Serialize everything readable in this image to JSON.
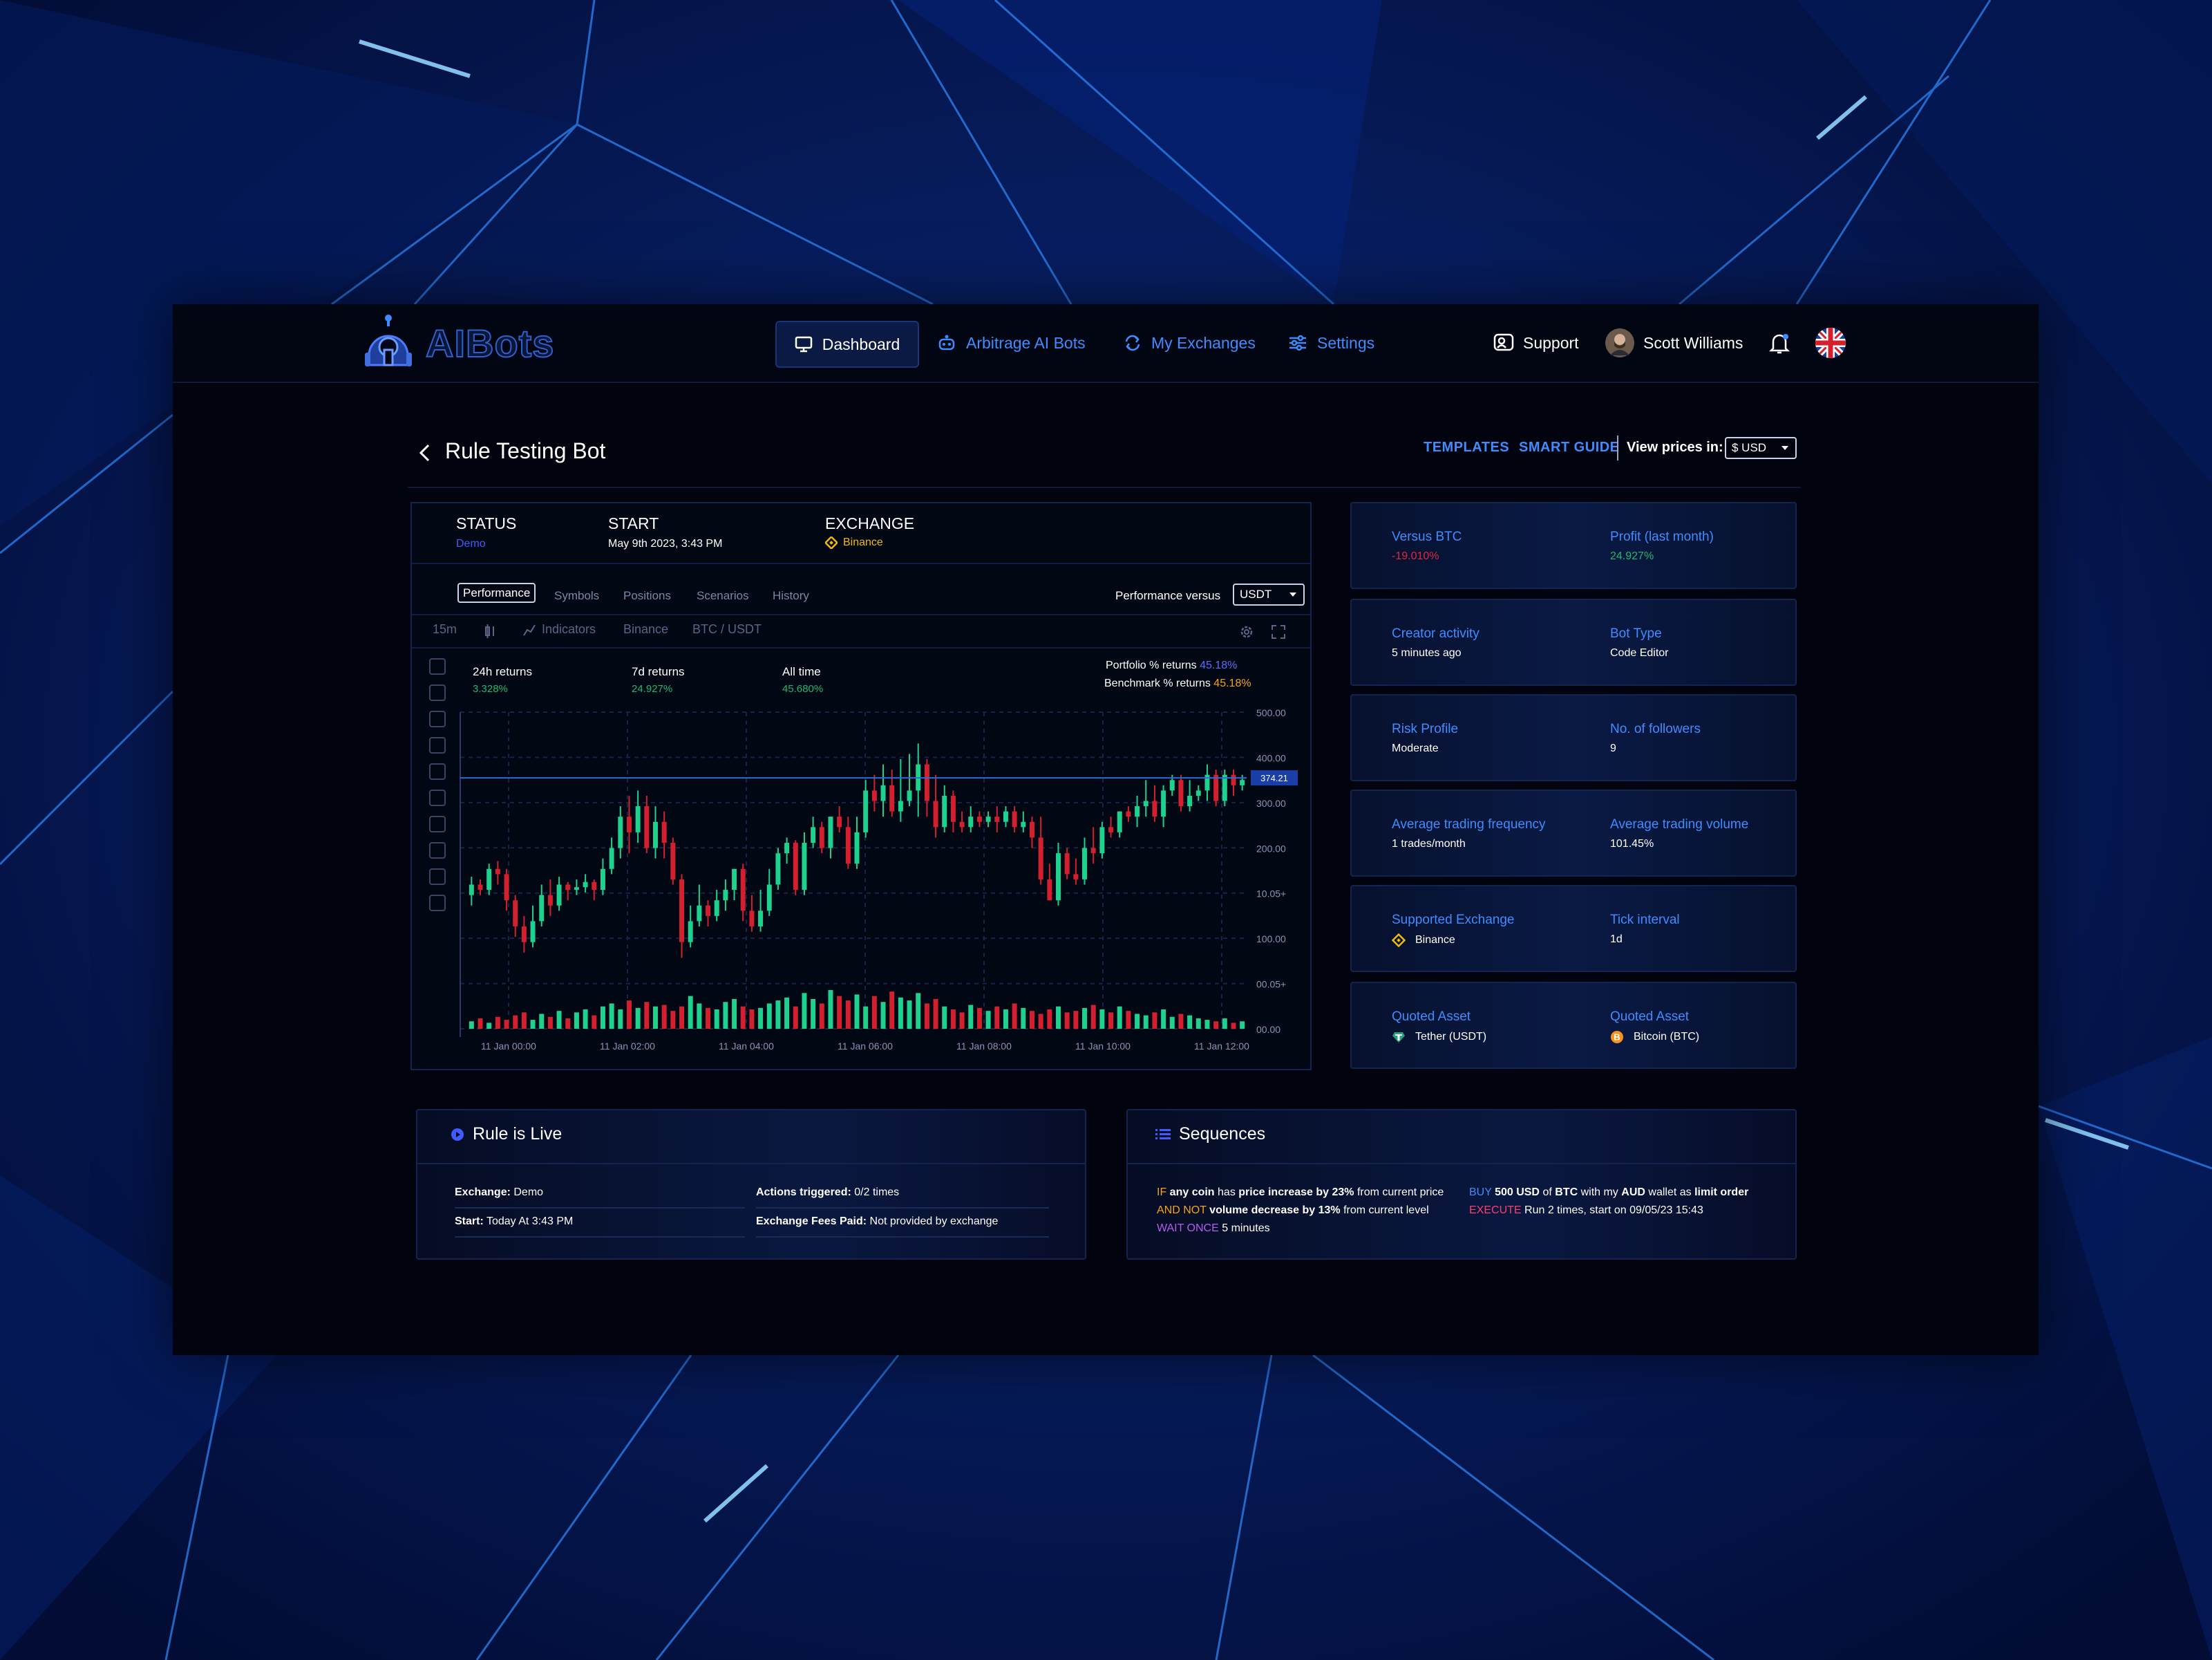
{
  "brand": {
    "name": "AIBots"
  },
  "nav": {
    "dashboard": "Dashboard",
    "arbitrage": "Arbitrage AI Bots",
    "exchanges": "My Exchanges",
    "settings": "Settings"
  },
  "header": {
    "support": "Support",
    "user_name": "Scott Williams",
    "language_flag": "uk-flag-icon"
  },
  "page": {
    "title": "Rule Testing Bot",
    "templates": "TEMPLATES",
    "smart_guide": "SMART GUIDE",
    "view_prices_label": "View prices in:",
    "currency": "$ USD"
  },
  "status": {
    "status_label": "STATUS",
    "status_value": "Demo",
    "start_label": "START",
    "start_value": "May 9th 2023, 3:43 PM",
    "exchange_label": "EXCHANGE",
    "exchange_value": "Binance"
  },
  "tabs": [
    "Performance",
    "Symbols",
    "Positions",
    "Scenarios",
    "History"
  ],
  "performance_versus": {
    "label": "Performance versus",
    "value": "USDT"
  },
  "toolbar": {
    "interval": "15m",
    "indicators": "Indicators",
    "exchange": "Binance",
    "pair": "BTC / USDT"
  },
  "returns": {
    "r24_label": "24h returns",
    "r24_value": "3.328%",
    "r7_label": "7d returns",
    "r7_value": "24.927%",
    "all_label": "All time",
    "all_value": "45.680%",
    "portfolio_label": "Portfolio % returns",
    "portfolio_value": "45.18%",
    "benchmark_label": "Benchmark % returns",
    "benchmark_value": "45.18%"
  },
  "chart_data": {
    "type": "candlestick",
    "x_ticks": [
      "11 Jan 00:00",
      "11 Jan 02:00",
      "11 Jan 04:00",
      "11 Jan 06:00",
      "11 Jan 08:00",
      "11 Jan 10:00",
      "11 Jan 12:00"
    ],
    "y_ticks": [
      "500.00",
      "400.00",
      "300.00",
      "200.00",
      "10.05+",
      "100.00",
      "00.05+",
      "00.00"
    ],
    "ylim": [
      0,
      500
    ],
    "last_price": "374.21",
    "up_color": "#1fd18e",
    "down_color": "#d4202e",
    "candles": [
      [
        150,
        170,
        130,
        185
      ],
      [
        170,
        160,
        150,
        180
      ],
      [
        160,
        200,
        150,
        210
      ],
      [
        200,
        190,
        170,
        215
      ],
      [
        190,
        140,
        120,
        200
      ],
      [
        140,
        90,
        70,
        150
      ],
      [
        90,
        60,
        40,
        110
      ],
      [
        60,
        100,
        50,
        130
      ],
      [
        100,
        150,
        90,
        170
      ],
      [
        150,
        130,
        110,
        180
      ],
      [
        130,
        170,
        120,
        185
      ],
      [
        170,
        160,
        140,
        175
      ],
      [
        160,
        165,
        150,
        180
      ],
      [
        165,
        175,
        155,
        190
      ],
      [
        175,
        160,
        140,
        180
      ],
      [
        160,
        200,
        150,
        220
      ],
      [
        200,
        240,
        190,
        260
      ],
      [
        240,
        300,
        220,
        320
      ],
      [
        300,
        270,
        230,
        340
      ],
      [
        270,
        320,
        250,
        350
      ],
      [
        320,
        240,
        230,
        340
      ],
      [
        240,
        290,
        220,
        320
      ],
      [
        290,
        250,
        220,
        310
      ],
      [
        250,
        180,
        170,
        260
      ],
      [
        180,
        60,
        30,
        190
      ],
      [
        60,
        100,
        50,
        130
      ],
      [
        100,
        130,
        90,
        170
      ],
      [
        130,
        110,
        90,
        140
      ],
      [
        110,
        140,
        100,
        160
      ],
      [
        140,
        160,
        120,
        180
      ],
      [
        160,
        200,
        140,
        200
      ],
      [
        200,
        120,
        100,
        210
      ],
      [
        120,
        90,
        80,
        150
      ],
      [
        90,
        120,
        80,
        160
      ],
      [
        120,
        170,
        110,
        200
      ],
      [
        170,
        230,
        160,
        240
      ],
      [
        230,
        250,
        210,
        260
      ],
      [
        250,
        160,
        150,
        255
      ],
      [
        160,
        250,
        150,
        270
      ],
      [
        250,
        280,
        240,
        300
      ],
      [
        280,
        240,
        230,
        290
      ],
      [
        240,
        300,
        220,
        300
      ],
      [
        300,
        280,
        270,
        320
      ],
      [
        280,
        210,
        200,
        300
      ],
      [
        210,
        270,
        200,
        300
      ],
      [
        270,
        350,
        260,
        370
      ],
      [
        350,
        330,
        310,
        380
      ],
      [
        330,
        360,
        300,
        400
      ],
      [
        360,
        310,
        300,
        390
      ],
      [
        310,
        330,
        290,
        410
      ],
      [
        330,
        350,
        320,
        420
      ],
      [
        350,
        400,
        300,
        440
      ],
      [
        400,
        330,
        300,
        410
      ],
      [
        330,
        280,
        260,
        380
      ],
      [
        280,
        340,
        270,
        360
      ],
      [
        340,
        290,
        270,
        350
      ],
      [
        290,
        280,
        270,
        310
      ],
      [
        280,
        300,
        270,
        320
      ],
      [
        300,
        290,
        280,
        310
      ],
      [
        290,
        300,
        280,
        310
      ],
      [
        300,
        290,
        270,
        320
      ],
      [
        290,
        310,
        280,
        320
      ],
      [
        310,
        280,
        270,
        320
      ],
      [
        280,
        290,
        270,
        310
      ],
      [
        290,
        260,
        240,
        300
      ],
      [
        260,
        180,
        170,
        300
      ],
      [
        180,
        140,
        140,
        210
      ],
      [
        140,
        230,
        130,
        250
      ],
      [
        230,
        190,
        180,
        240
      ],
      [
        190,
        180,
        170,
        220
      ],
      [
        180,
        240,
        170,
        260
      ],
      [
        240,
        230,
        210,
        280
      ],
      [
        230,
        280,
        220,
        290
      ],
      [
        280,
        270,
        260,
        300
      ],
      [
        270,
        310,
        260,
        310
      ],
      [
        310,
        300,
        290,
        320
      ],
      [
        300,
        320,
        280,
        340
      ],
      [
        320,
        330,
        300,
        370
      ],
      [
        330,
        300,
        290,
        360
      ],
      [
        300,
        350,
        280,
        360
      ],
      [
        350,
        370,
        340,
        380
      ],
      [
        370,
        320,
        310,
        380
      ],
      [
        320,
        340,
        310,
        370
      ],
      [
        340,
        350,
        330,
        360
      ],
      [
        350,
        380,
        330,
        400
      ],
      [
        380,
        330,
        320,
        390
      ],
      [
        330,
        380,
        320,
        390
      ],
      [
        380,
        360,
        340,
        390
      ],
      [
        360,
        370,
        350,
        380
      ]
    ],
    "volumes": [
      10,
      14,
      8,
      16,
      12,
      18,
      22,
      12,
      20,
      16,
      24,
      14,
      22,
      26,
      18,
      30,
      34,
      26,
      38,
      28,
      36,
      30,
      32,
      24,
      30,
      44,
      34,
      28,
      26,
      36,
      40,
      30,
      26,
      28,
      34,
      38,
      42,
      30,
      48,
      40,
      34,
      52,
      44,
      38,
      46,
      30,
      44,
      36,
      50,
      42,
      38,
      48,
      34,
      40,
      30,
      26,
      22,
      32,
      28,
      24,
      30,
      26,
      34,
      28,
      24,
      20,
      26,
      30,
      22,
      24,
      28,
      32,
      26,
      22,
      30,
      24,
      20,
      18,
      22,
      26,
      16,
      20,
      18,
      14,
      12,
      10,
      14,
      8,
      10
    ]
  },
  "info_cards": [
    {
      "k1": "Versus BTC",
      "v1": "-19.010%",
      "k2": "Profit (last month)",
      "v2": "24.927%"
    },
    {
      "k1": "Creator activity",
      "v1": "5 minutes ago",
      "k2": "Bot Type",
      "v2": "Code Editor"
    },
    {
      "k1": "Risk Profile",
      "v1": "Moderate",
      "k2": "No. of followers",
      "v2": "9"
    },
    {
      "k1": "Average trading frequency",
      "v1": "1 trades/month",
      "k2": "Average trading volume",
      "v2": "101.45%"
    },
    {
      "k1": "Supported Exchange",
      "v1": "Binance",
      "k2": "Tick interval",
      "v2": "1d"
    },
    {
      "k1": "Quoted Asset",
      "v1": "Tether (USDT)",
      "k2": "Quoted Asset",
      "v2": "Bitcoin (BTC)"
    }
  ],
  "rule": {
    "title": "Rule is Live",
    "exchange_label": "Exchange:",
    "exchange_value": "Demo",
    "start_label": "Start:",
    "start_value": "Today At 3:43 PM",
    "actions_label": "Actions triggered:",
    "actions_value": "0/2 times",
    "fees_label": "Exchange Fees Paid:",
    "fees_value": "Not provided by exchange"
  },
  "sequences": {
    "title": "Sequences",
    "l1": {
      "kw": "IF",
      "a": "any coin",
      "b": "has",
      "c": "price increase by 23%",
      "d": "from current price"
    },
    "l2": {
      "kw": "AND NOT",
      "a": "volume decrease by 13%",
      "b": "from current level"
    },
    "l3": {
      "kw": "WAIT ONCE",
      "a": "5 minutes"
    },
    "r1": {
      "kw": "BUY",
      "a": "500 USD",
      "b": "of",
      "c": "BTC",
      "d": "with my",
      "e": "AUD",
      "f": "wallet as",
      "g": "limit order"
    },
    "r2": {
      "kw": "EXECUTE",
      "a": "Run 2 times, start on 09/05/23 15:43"
    }
  },
  "colors": {
    "accent": "#3f8cff",
    "positive": "#1fb86b",
    "negative": "#e0283b",
    "binance": "#f0b90b",
    "portfolio": "#5b6cff",
    "benchmark": "#f5a31a"
  }
}
